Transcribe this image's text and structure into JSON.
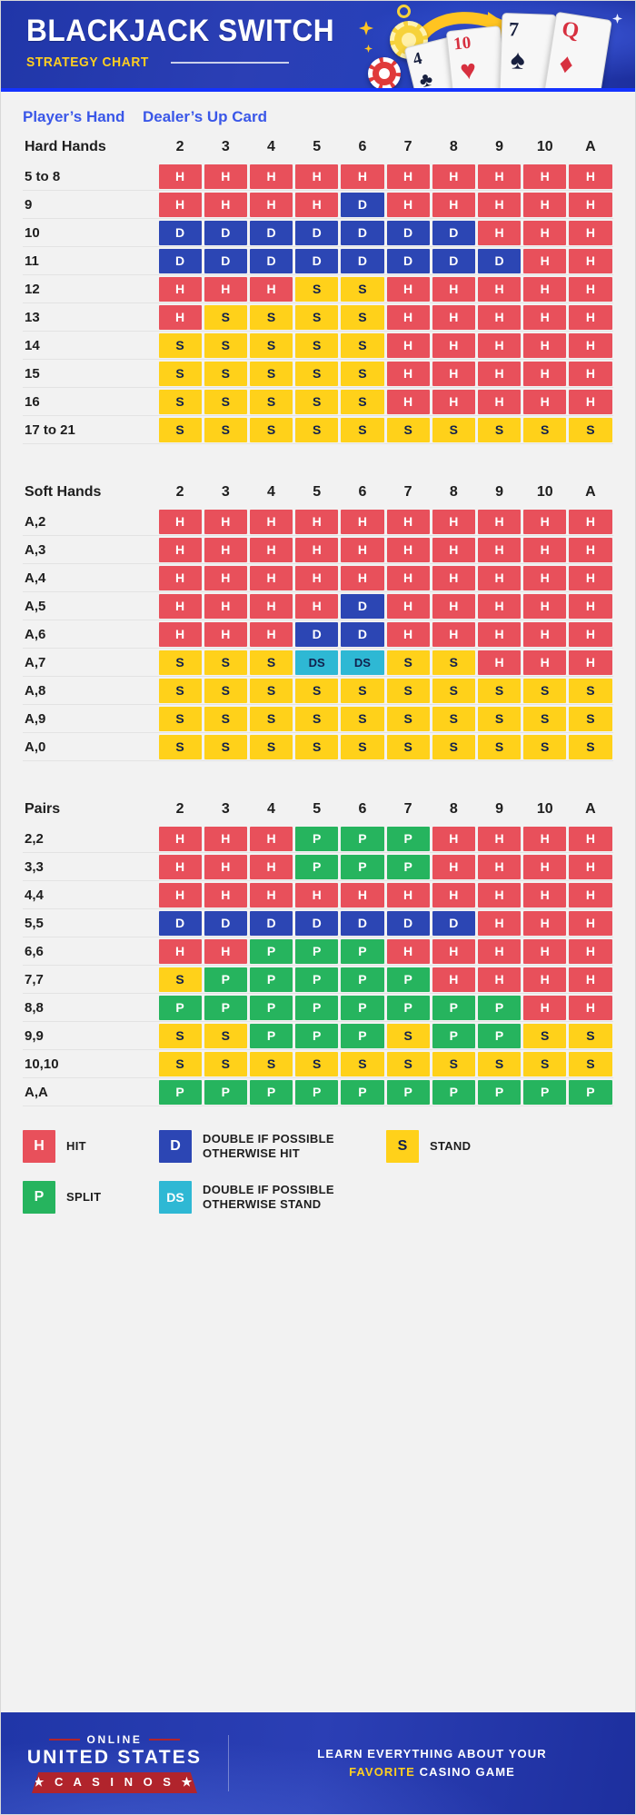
{
  "header": {
    "title": "BLACKJACK SWITCH",
    "subtitle": "STRATEGY CHART",
    "cards": [
      {
        "rank": "4",
        "suit": "♣"
      },
      {
        "rank": "10",
        "suit": "♥"
      },
      {
        "rank": "7",
        "suit": "♠"
      },
      {
        "rank": "Q",
        "suit": "♦"
      }
    ]
  },
  "column_headers": {
    "player": "Player’s Hand",
    "dealer": "Dealer’s Up Card"
  },
  "dealer_cards": [
    "2",
    "3",
    "4",
    "5",
    "6",
    "7",
    "8",
    "9",
    "10",
    "A"
  ],
  "chart_data": {
    "type": "table",
    "title": "Blackjack Switch Strategy Chart",
    "xlabel": "Dealer's Up Card",
    "ylabel": "Player's Hand",
    "categories": [
      "2",
      "3",
      "4",
      "5",
      "6",
      "7",
      "8",
      "9",
      "10",
      "A"
    ],
    "legend_position": "bottom",
    "sections": [
      {
        "name": "Hard Hands",
        "rows": [
          {
            "label": "5 to 8",
            "values": [
              "H",
              "H",
              "H",
              "H",
              "H",
              "H",
              "H",
              "H",
              "H",
              "H"
            ]
          },
          {
            "label": "9",
            "values": [
              "H",
              "H",
              "H",
              "H",
              "D",
              "H",
              "H",
              "H",
              "H",
              "H"
            ]
          },
          {
            "label": "10",
            "values": [
              "D",
              "D",
              "D",
              "D",
              "D",
              "D",
              "D",
              "H",
              "H",
              "H"
            ]
          },
          {
            "label": "11",
            "values": [
              "D",
              "D",
              "D",
              "D",
              "D",
              "D",
              "D",
              "D",
              "H",
              "H"
            ]
          },
          {
            "label": "12",
            "values": [
              "H",
              "H",
              "H",
              "S",
              "S",
              "H",
              "H",
              "H",
              "H",
              "H"
            ]
          },
          {
            "label": "13",
            "values": [
              "H",
              "S",
              "S",
              "S",
              "S",
              "H",
              "H",
              "H",
              "H",
              "H"
            ]
          },
          {
            "label": "14",
            "values": [
              "S",
              "S",
              "S",
              "S",
              "S",
              "H",
              "H",
              "H",
              "H",
              "H"
            ]
          },
          {
            "label": "15",
            "values": [
              "S",
              "S",
              "S",
              "S",
              "S",
              "H",
              "H",
              "H",
              "H",
              "H"
            ]
          },
          {
            "label": "16",
            "values": [
              "S",
              "S",
              "S",
              "S",
              "S",
              "H",
              "H",
              "H",
              "H",
              "H"
            ]
          },
          {
            "label": "17 to 21",
            "values": [
              "S",
              "S",
              "S",
              "S",
              "S",
              "S",
              "S",
              "S",
              "S",
              "S"
            ]
          }
        ]
      },
      {
        "name": "Soft Hands",
        "rows": [
          {
            "label": "A,2",
            "values": [
              "H",
              "H",
              "H",
              "H",
              "H",
              "H",
              "H",
              "H",
              "H",
              "H"
            ]
          },
          {
            "label": "A,3",
            "values": [
              "H",
              "H",
              "H",
              "H",
              "H",
              "H",
              "H",
              "H",
              "H",
              "H"
            ]
          },
          {
            "label": "A,4",
            "values": [
              "H",
              "H",
              "H",
              "H",
              "H",
              "H",
              "H",
              "H",
              "H",
              "H"
            ]
          },
          {
            "label": "A,5",
            "values": [
              "H",
              "H",
              "H",
              "H",
              "D",
              "H",
              "H",
              "H",
              "H",
              "H"
            ]
          },
          {
            "label": "A,6",
            "values": [
              "H",
              "H",
              "H",
              "D",
              "D",
              "H",
              "H",
              "H",
              "H",
              "H"
            ]
          },
          {
            "label": "A,7",
            "values": [
              "S",
              "S",
              "S",
              "DS",
              "DS",
              "S",
              "S",
              "H",
              "H",
              "H"
            ]
          },
          {
            "label": "A,8",
            "values": [
              "S",
              "S",
              "S",
              "S",
              "S",
              "S",
              "S",
              "S",
              "S",
              "S"
            ]
          },
          {
            "label": "A,9",
            "values": [
              "S",
              "S",
              "S",
              "S",
              "S",
              "S",
              "S",
              "S",
              "S",
              "S"
            ]
          },
          {
            "label": "A,0",
            "values": [
              "S",
              "S",
              "S",
              "S",
              "S",
              "S",
              "S",
              "S",
              "S",
              "S"
            ]
          }
        ]
      },
      {
        "name": "Pairs",
        "rows": [
          {
            "label": "2,2",
            "values": [
              "H",
              "H",
              "H",
              "P",
              "P",
              "P",
              "H",
              "H",
              "H",
              "H"
            ]
          },
          {
            "label": "3,3",
            "values": [
              "H",
              "H",
              "H",
              "P",
              "P",
              "P",
              "H",
              "H",
              "H",
              "H"
            ]
          },
          {
            "label": "4,4",
            "values": [
              "H",
              "H",
              "H",
              "H",
              "H",
              "H",
              "H",
              "H",
              "H",
              "H"
            ]
          },
          {
            "label": "5,5",
            "values": [
              "D",
              "D",
              "D",
              "D",
              "D",
              "D",
              "D",
              "H",
              "H",
              "H"
            ]
          },
          {
            "label": "6,6",
            "values": [
              "H",
              "H",
              "P",
              "P",
              "P",
              "H",
              "H",
              "H",
              "H",
              "H"
            ]
          },
          {
            "label": "7,7",
            "values": [
              "S",
              "P",
              "P",
              "P",
              "P",
              "P",
              "H",
              "H",
              "H",
              "H"
            ]
          },
          {
            "label": "8,8",
            "values": [
              "P",
              "P",
              "P",
              "P",
              "P",
              "P",
              "P",
              "P",
              "H",
              "H"
            ]
          },
          {
            "label": "9,9",
            "values": [
              "S",
              "S",
              "P",
              "P",
              "P",
              "S",
              "P",
              "P",
              "S",
              "S"
            ]
          },
          {
            "label": "10,10",
            "values": [
              "S",
              "S",
              "S",
              "S",
              "S",
              "S",
              "S",
              "S",
              "S",
              "S"
            ]
          },
          {
            "label": "A,A",
            "values": [
              "P",
              "P",
              "P",
              "P",
              "P",
              "P",
              "P",
              "P",
              "P",
              "P"
            ]
          }
        ]
      }
    ],
    "legend": [
      {
        "code": "H",
        "label": "HIT"
      },
      {
        "code": "D",
        "label": "DOUBLE IF POSSIBLE OTHERWISE HIT",
        "line1": "DOUBLE IF POSSIBLE",
        "line2": "OTHERWISE HIT"
      },
      {
        "code": "S",
        "label": "STAND"
      },
      {
        "code": "P",
        "label": "SPLIT"
      },
      {
        "code": "DS",
        "label": "DOUBLE IF POSSIBLE OTHERWISE STAND",
        "line1": "DOUBLE IF POSSIBLE",
        "line2": "OTHERWISE STAND"
      }
    ],
    "colors": {
      "hit": "#e8505b",
      "double": "#2c46b4",
      "stand": "#ffd11a",
      "split": "#26b45e",
      "double_stand": "#2eb8d4",
      "header_blue": "#3a57e8",
      "brand_blue": "#2b3fb5",
      "brand_red": "#b1242c",
      "brand_gold": "#ffcf20"
    }
  },
  "footer": {
    "brand_line1": "ONLINE",
    "brand_line2": "UNITED STATES",
    "brand_line3": "★ C A S I N O S ★",
    "tagline_line1": "LEARN EVERYTHING ABOUT YOUR",
    "tagline_line2_highlight": "FAVORITE",
    "tagline_line2_rest": "CASINO GAME"
  }
}
